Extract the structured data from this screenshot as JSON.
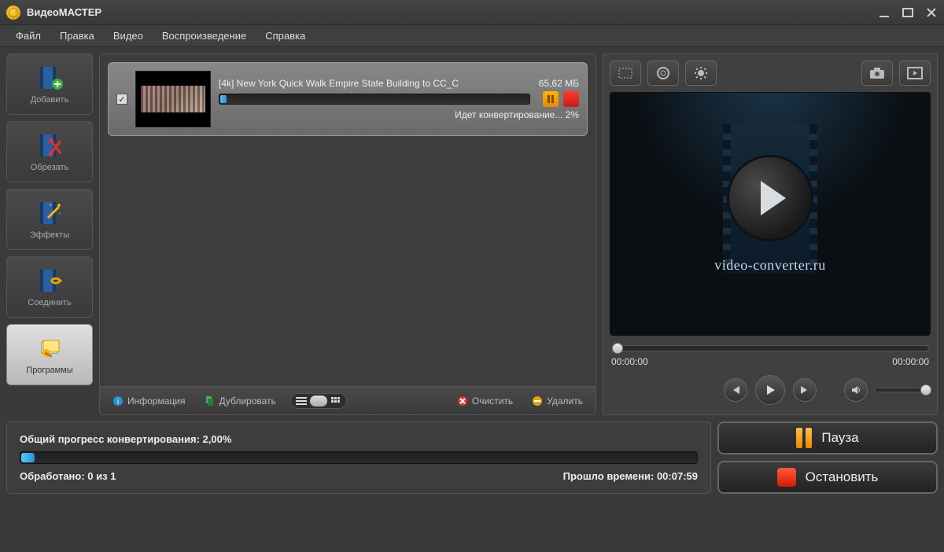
{
  "titlebar": {
    "title": "ВидеоМАСТЕР"
  },
  "menu": {
    "file": "Файл",
    "edit": "Правка",
    "video": "Видео",
    "playback": "Воспроизведение",
    "help": "Справка"
  },
  "sidebar": {
    "add": "Добавить",
    "trim": "Обрезать",
    "effects": "Эффекты",
    "join": "Соединить",
    "programs": "Программы"
  },
  "item": {
    "title": "[4k] New York Quick Walk Empire State Building to CC_C",
    "size": "65,62 МБ",
    "status": "Идет конвертирование...  2%"
  },
  "centerToolbar": {
    "info": "Информация",
    "duplicate": "Дублировать",
    "clear": "Очистить",
    "delete": "Удалить"
  },
  "preview": {
    "url": "video-converter.ru",
    "timeStart": "00:00:00",
    "timeEnd": "00:00:00"
  },
  "overall": {
    "label": "Общий прогресс конвертирования: ",
    "percent": "2,00%",
    "processedLabel": "Обработано: ",
    "processedValue": "0 из 1",
    "elapsedLabel": "Прошло времени: ",
    "elapsedValue": "00:07:59"
  },
  "actions": {
    "pause": "Пауза",
    "stop": "Остановить"
  }
}
